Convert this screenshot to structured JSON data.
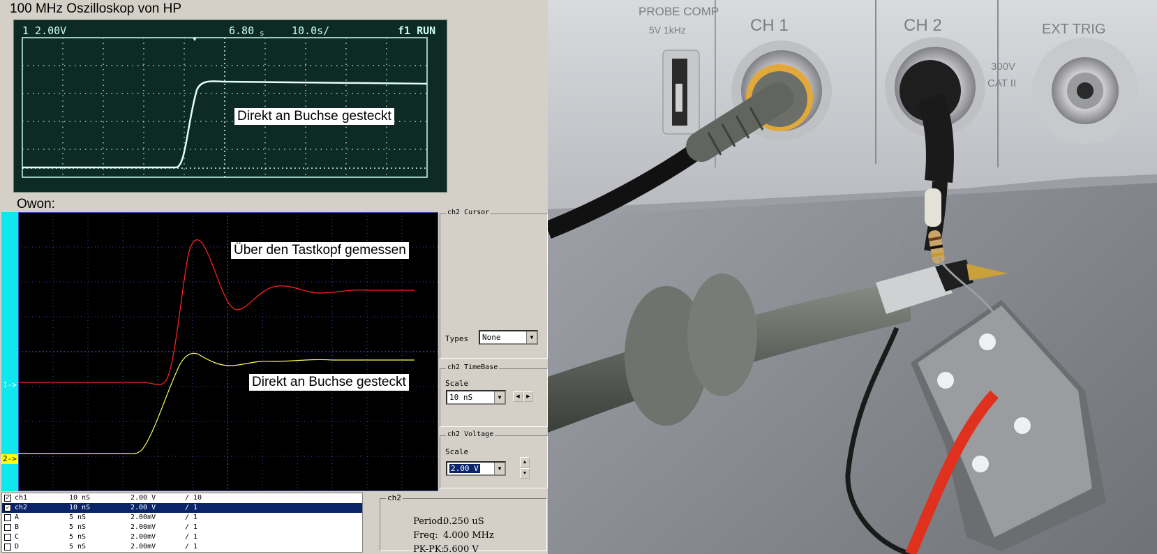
{
  "hp": {
    "title": "100 MHz Oszilloskop von HP",
    "status_ch": "1 2.00V",
    "status_delay": "6.80",
    "status_delay_unit": "s",
    "status_time": "10.0s/",
    "status_mode": "f1 RUN",
    "annotation": "Direkt an Buchse gesteckt"
  },
  "owon": {
    "label": "Owon:",
    "marker1": "1->",
    "marker2": "2->",
    "annotation_red": "Über den Tastkopf gemessen",
    "annotation_yellow": "Direkt an Buchse gesteckt"
  },
  "cursor_group": {
    "title": "ch2 Cursor",
    "types_label": "Types",
    "types_value": "None"
  },
  "timebase_group": {
    "title": "ch2 TimeBase",
    "scale_label": "Scale",
    "scale_value": "10 nS"
  },
  "voltage_group": {
    "title": "ch2 Voltage",
    "scale_label": "Scale",
    "scale_value": "2.00 V"
  },
  "channels": [
    {
      "name": "ch1",
      "time": "10 nS",
      "volt": "2.00 V",
      "probe": "/ 10",
      "checked": "✓"
    },
    {
      "name": "ch2",
      "time": "10 nS",
      "volt": "2.00 V",
      "probe": "/ 1",
      "checked": "✓"
    },
    {
      "name": "A",
      "time": "5 nS",
      "volt": "2.00mV",
      "probe": "/ 1",
      "checked": ""
    },
    {
      "name": "B",
      "time": "5 nS",
      "volt": "2.00mV",
      "probe": "/ 1",
      "checked": ""
    },
    {
      "name": "C",
      "time": "5 nS",
      "volt": "2.00mV",
      "probe": "/ 1",
      "checked": ""
    },
    {
      "name": "D",
      "time": "5 nS",
      "volt": "2.00mV",
      "probe": "/ 1",
      "checked": ""
    }
  ],
  "measure": {
    "title": "ch2",
    "period_label": "Period:",
    "period_value": "0.250 uS",
    "freq_label": "Freq:",
    "freq_value": "4.000 MHz",
    "pkpk_label": "PK-PK:",
    "pkpk_value": "5.600 V"
  },
  "photo_labels": {
    "probe_comp": "PROBE COMP",
    "probe_comp_sub": "5V 1kHz",
    "ch1": "CH 1",
    "ch2": "CH 2",
    "ext_trig": "EXT TRIG",
    "rating": "300V",
    "rating_cat": "CAT II"
  },
  "colors": {
    "owon_ch1": "#ff2020",
    "owon_ch2": "#ffff60",
    "hp_trace": "#c8fff0",
    "owon_side": "#10e6ee"
  }
}
